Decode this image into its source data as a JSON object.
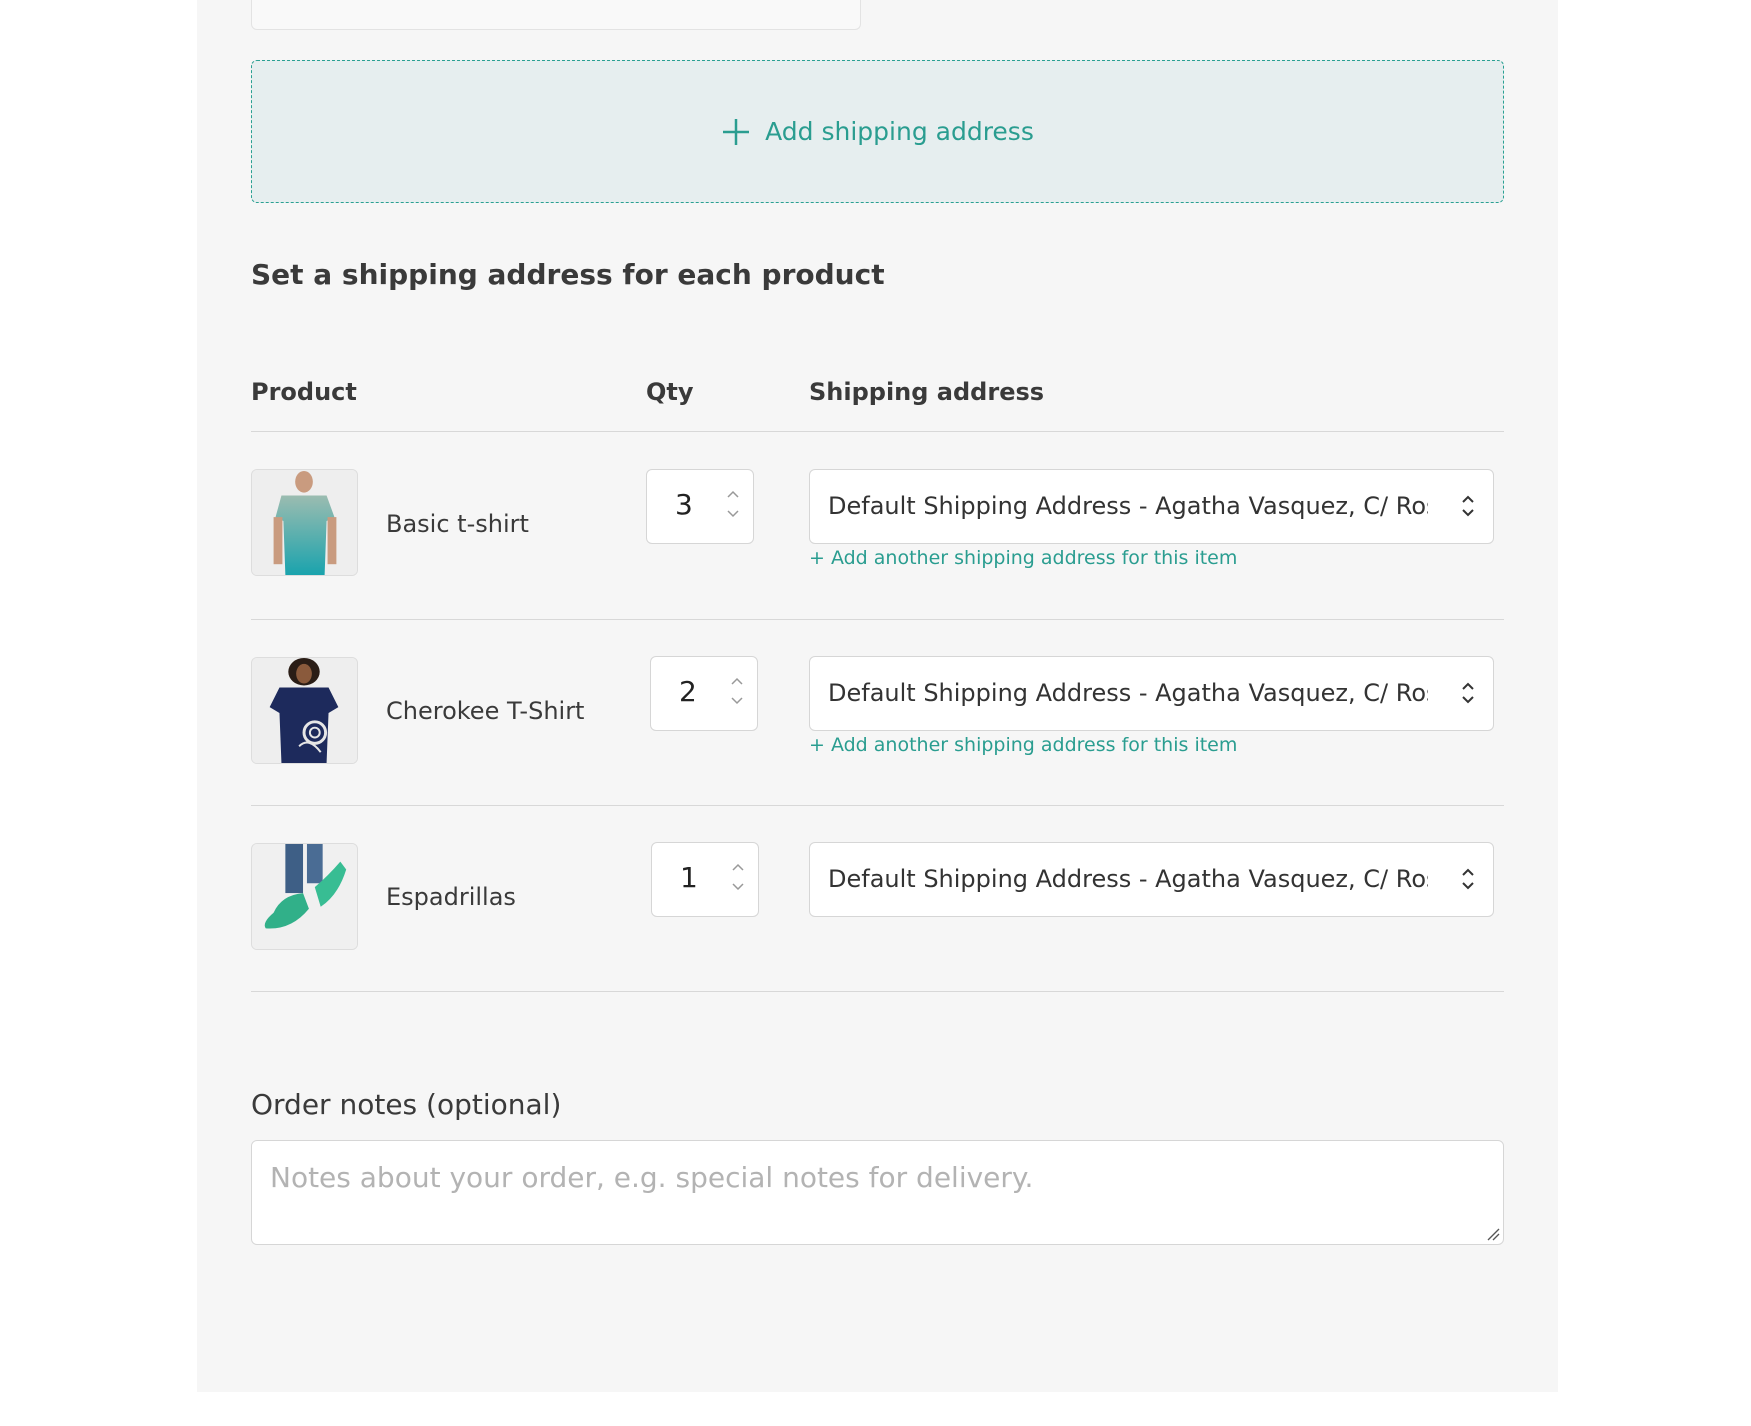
{
  "add_address": {
    "label": "Add shipping address",
    "icon": "plus-icon"
  },
  "section_title": "Set a shipping address for each product",
  "table": {
    "headers": {
      "product": "Product",
      "qty": "Qty",
      "shipping": "Shipping address"
    },
    "rows": [
      {
        "name": "Basic t-shirt",
        "qty": "3",
        "address": "Default Shipping Address - Agatha Vasquez, C/ Rosa ...",
        "add_another": "+ Add another shipping address for this item"
      },
      {
        "name": "Cherokee T-Shirt",
        "qty": "2",
        "address": "Default Shipping Address - Agatha Vasquez, C/ Rosa ...",
        "add_another": "+ Add another shipping address for this item"
      },
      {
        "name": "Espadrillas",
        "qty": "1",
        "address": "Default Shipping Address - Agatha Vasquez, C/ Rosa ..."
      }
    ]
  },
  "notes": {
    "label": "Order notes (optional)",
    "placeholder": "Notes about your order, e.g. special notes for delivery."
  },
  "colors": {
    "accent": "#2a9d90",
    "panel_bg": "#f6f6f6",
    "dashed_box_bg": "#e6eeef"
  }
}
